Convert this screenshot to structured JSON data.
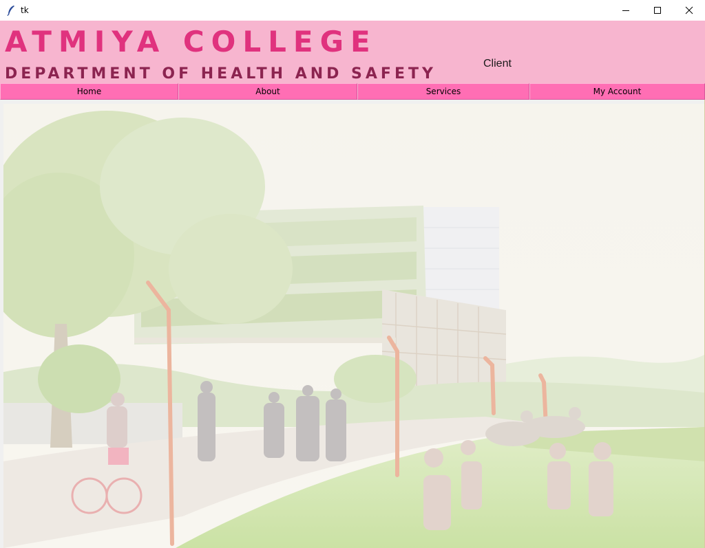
{
  "window": {
    "title": "tk",
    "app_icon": "feather-icon",
    "controls": [
      "minimize-icon",
      "maximize-icon",
      "close-icon"
    ]
  },
  "header": {
    "college_name": "ATMIYA COLLEGE",
    "department": "DEPARTMENT OF HEALTH AND SAFETY",
    "user_role": "Client"
  },
  "nav": {
    "home": "Home",
    "about": "About",
    "services": "Services",
    "account": "My Account"
  },
  "colors": {
    "header_bg": "#f7b5cf",
    "college_name": "#e0327e",
    "department": "#8c2450",
    "nav_bg": "#ff6eb4"
  },
  "content": {
    "image": "campus-illustration"
  }
}
